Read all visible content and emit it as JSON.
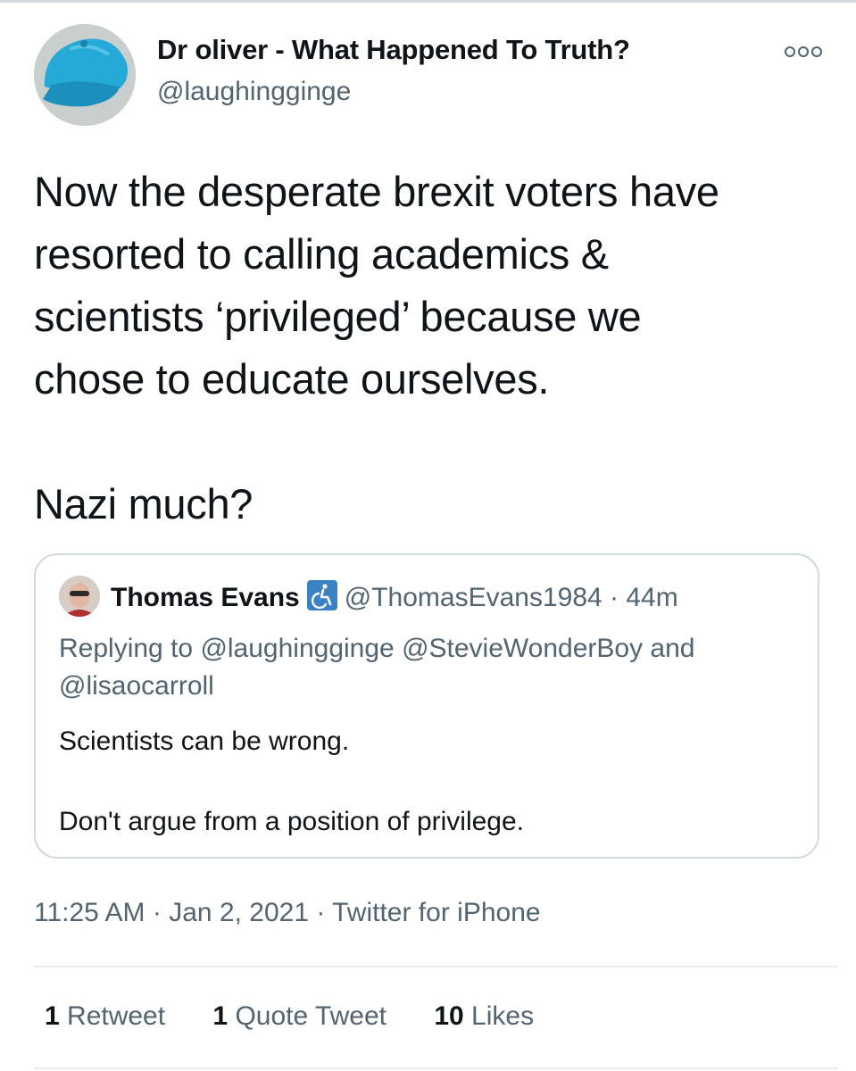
{
  "author": {
    "display_name": "Dr oliver - What Happened To Truth?",
    "handle": "@laughingginge",
    "avatar_icon": "blue-cap-avatar"
  },
  "menu_icon": "more-dots-icon",
  "tweet": {
    "text": "Now the desperate brexit voters have\nresorted to calling academics &\nscientists ‘privileged’ because we\nchose to educate ourselves.\n\nNazi much?"
  },
  "quote": {
    "author_name": "Thomas Evans",
    "badge_icon": "wheelchair-icon",
    "handle": "@ThomasEvans1984",
    "separator": " · ",
    "time": "44m",
    "replying_prefix": "Replying to ",
    "replying_to": "@laughingginge @StevieWonderBoy and @lisaocarroll",
    "text": "Scientists can be wrong.\n\nDon't argue from a position of privilege."
  },
  "meta": {
    "time": "11:25 AM",
    "sep1": " · ",
    "date": "Jan 2, 2021",
    "sep2": " · ",
    "source": "Twitter for iPhone"
  },
  "stats": {
    "retweets_count": "1",
    "retweets_label": " Retweet",
    "quotes_count": "1",
    "quotes_label": " Quote Tweet",
    "likes_count": "10",
    "likes_label": " Likes"
  },
  "colors": {
    "primary_text": "#0f1419",
    "secondary_text": "#536471",
    "border": "#cfd9de",
    "badge": "#3b82c4"
  }
}
